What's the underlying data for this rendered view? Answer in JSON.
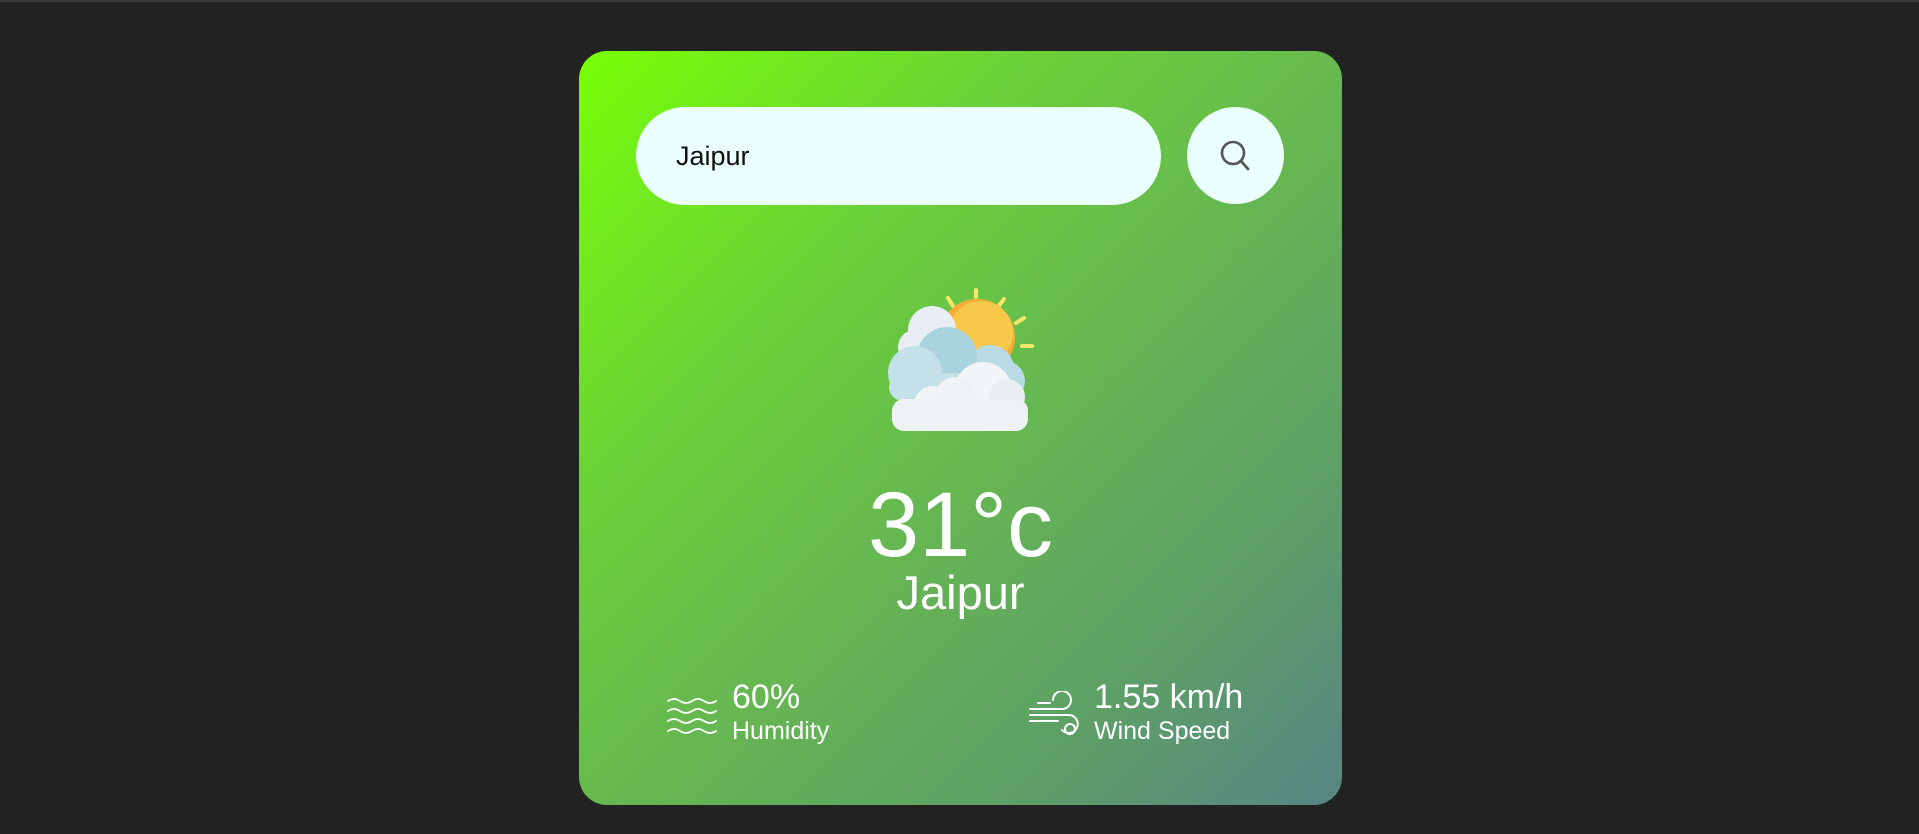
{
  "search": {
    "value": "Jaipur",
    "icon": "search-icon"
  },
  "weather": {
    "icon": "partly-cloudy-sun-icon",
    "temperature": "31°c",
    "city": "Jaipur"
  },
  "details": {
    "humidity": {
      "value": "60%",
      "label": "Humidity",
      "icon": "humidity-waves-icon"
    },
    "wind": {
      "value": "1.55 km/h",
      "label": "Wind Speed",
      "icon": "wind-icon"
    }
  },
  "colors": {
    "page_background": "#222222",
    "card_gradient_start": "#77ff07",
    "card_gradient_end": "#578585",
    "input_background": "#ebfffc",
    "text": "#ffffff"
  }
}
